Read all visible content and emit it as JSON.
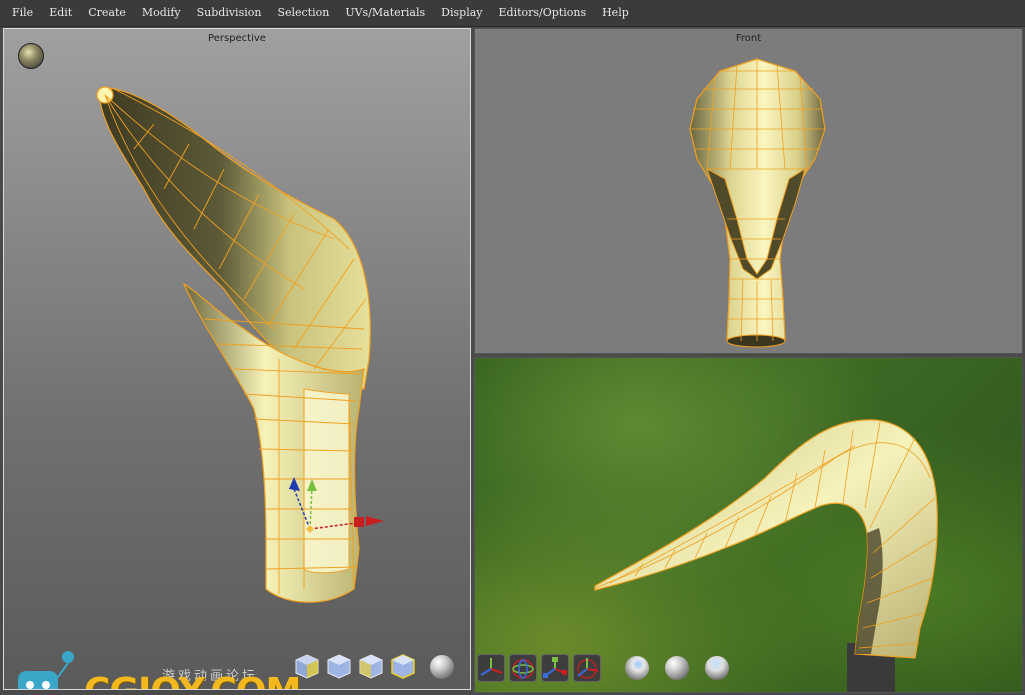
{
  "menubar": {
    "items": [
      "File",
      "Edit",
      "Create",
      "Modify",
      "Subdivision",
      "Selection",
      "UVs/Materials",
      "Display",
      "Editors/Options",
      "Help"
    ]
  },
  "viewports": {
    "perspective": {
      "label": "Perspective"
    },
    "front": {
      "label": "Front"
    },
    "render": {
      "label": ""
    }
  },
  "perspective_toolbar": {
    "icons": [
      "cube-wireframe-icon",
      "cube-shaded-icon",
      "cube-shaded-wire-icon",
      "cube-textured-icon",
      "sphere-material-icon"
    ]
  },
  "render_toolbar": {
    "icons": [
      "move-tool-icon",
      "rotate-tool-icon",
      "scale-tool-icon",
      "universal-tool-icon",
      "sphere-light-icon",
      "sphere-shade-icon",
      "sphere-env-icon"
    ]
  },
  "watermark": {
    "logo_text": "CGJOY.COM",
    "sub_text": "游戏动画论坛"
  },
  "colors": {
    "wire": "#f0a020",
    "face_light": "#f6f2b0",
    "face_mid": "#c9c47e",
    "face_dark": "#4e4b30",
    "gizmo_x": "#c81e1e",
    "gizmo_y": "#7ac040",
    "gizmo_z": "#1e3ab0"
  }
}
